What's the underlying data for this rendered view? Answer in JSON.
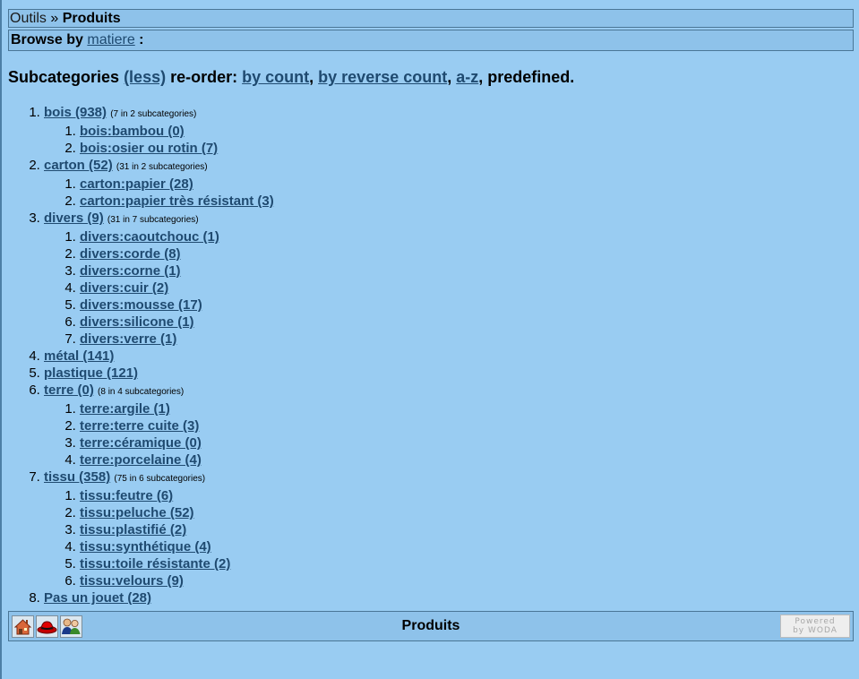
{
  "breadcrumb": {
    "parent": "Outils",
    "separator": " » ",
    "current": "Produits"
  },
  "browse": {
    "prefix": "Browse by",
    "link": "matiere",
    "suffix": " :"
  },
  "subcategories": {
    "title": "Subcategories",
    "less": "(less)",
    "reorder_label": "re-order:",
    "by_count": "by count",
    "by_reverse_count": "by reverse count",
    "az": "a-z",
    "predefined": "predefined."
  },
  "categories": [
    {
      "label": "bois (938)",
      "note": "(7 in 2 subcategories)",
      "children": [
        "bois:bambou (0)",
        "bois:osier ou rotin (7)"
      ]
    },
    {
      "label": "carton (52)",
      "note": "(31 in 2 subcategories)",
      "children": [
        "carton:papier (28)",
        "carton:papier très résistant (3)"
      ]
    },
    {
      "label": "divers (9)",
      "note": "(31 in 7 subcategories)",
      "children": [
        "divers:caoutchouc (1)",
        "divers:corde (8)",
        "divers:corne (1)",
        "divers:cuir (2)",
        "divers:mousse (17)",
        "divers:silicone (1)",
        "divers:verre (1)"
      ]
    },
    {
      "label": "métal (141)",
      "note": "",
      "children": []
    },
    {
      "label": "plastique (121)",
      "note": "",
      "children": []
    },
    {
      "label": "terre (0)",
      "note": "(8 in 4 subcategories)",
      "children": [
        "terre:argile (1)",
        "terre:terre cuite (3)",
        "terre:céramique (0)",
        "terre:porcelaine (4)"
      ]
    },
    {
      "label": "tissu (358)",
      "note": "(75 in 6 subcategories)",
      "children": [
        "tissu:feutre (6)",
        "tissu:peluche (52)",
        "tissu:plastifié (2)",
        "tissu:synthétique (4)",
        "tissu:toile résistante (2)",
        "tissu:velours (9)"
      ]
    },
    {
      "label": "Pas un jouet (28)",
      "note": "",
      "children": []
    }
  ],
  "footer": {
    "title": "Produits",
    "icons": [
      "home-icon",
      "red-hat-icon",
      "users-icon"
    ],
    "powered_line1": "Powered",
    "powered_line2": "by WODA"
  },
  "colors": {
    "background": "#99ccf2",
    "bar": "#8ec2ea",
    "link": "#1f4a70"
  }
}
